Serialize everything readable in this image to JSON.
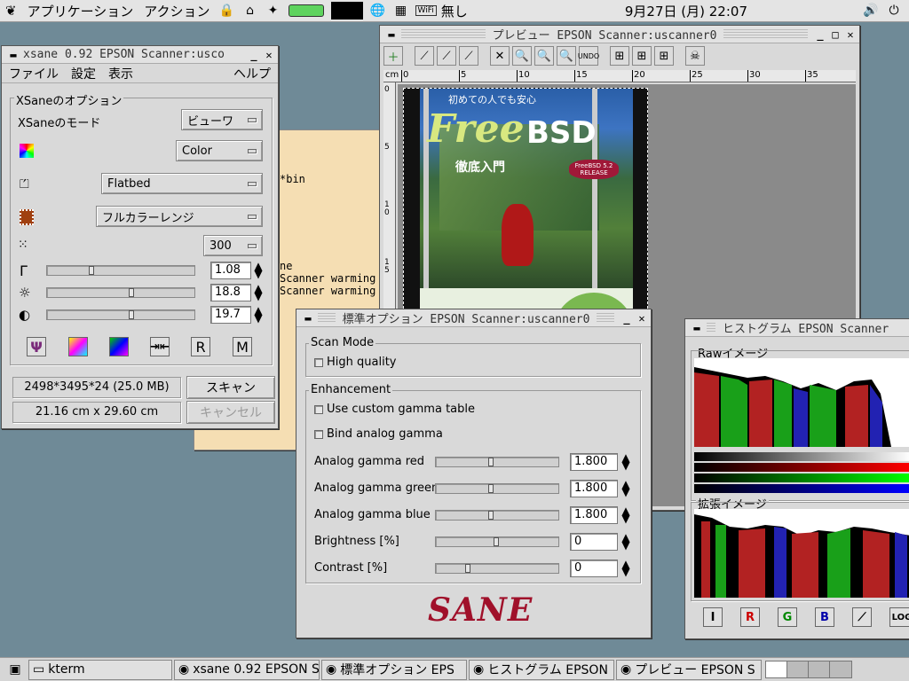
{
  "topbar": {
    "applications": "アプリケーション",
    "actions": "アクション",
    "wifi_label": "WiFi",
    "network_status": "無し",
    "clock": "9月27日 (月) 22:07"
  },
  "kterm": {
    "lines": [
      "*bin",
      "ne",
      "Scanner warming",
      "Scanner warming"
    ]
  },
  "xsane": {
    "title": "xsane 0.92 EPSON Scanner:usco",
    "menu": {
      "file": "ファイル",
      "settings": "設定",
      "view": "表示",
      "help": "ヘルプ"
    },
    "options_group": "XSaneのオプション",
    "mode_label": "XSaneのモード",
    "mode_value": "ビューワ",
    "color_value": "Color",
    "source_value": "Flatbed",
    "range_value": "フルカラーレンジ",
    "resolution_value": "300",
    "gamma_value": "1.08",
    "gamma_level": 0.3,
    "brightness_value": "18.8",
    "brightness_level": 0.58,
    "contrast_value": "19.7",
    "contrast_level": 0.58,
    "image_size": "2498*3495*24 (25.0 MB)",
    "dimensions": "21.16 cm x 29.60 cm",
    "scan_button": "スキャン",
    "cancel_button": "キャンセル",
    "bottom_buttons": [
      "R",
      "M"
    ]
  },
  "preview": {
    "title": "プレビュー EPSON Scanner:uscanner0",
    "unit": "cm",
    "ruler_ticks": [
      "0",
      "5",
      "10",
      "15",
      "20",
      "25",
      "30",
      "35"
    ],
    "vruler_ticks": [
      "0",
      "5",
      "10",
      "15"
    ],
    "cover_subtitle": "初めての人でも安心",
    "cover_title_a": "Free",
    "cover_title_b": "BSD",
    "cover_kanji": "徹底入門",
    "cover_badge": "FreeBSD 5.2 RELEASE"
  },
  "std_options": {
    "title": "標準オプション EPSON Scanner:uscanner0",
    "scan_mode_group": "Scan Mode",
    "high_quality": "High quality",
    "enhancement_group": "Enhancement",
    "custom_gamma": "Use custom gamma table",
    "bind_gamma": "Bind analog gamma",
    "rows": [
      {
        "label": "Analog gamma red",
        "value": "1.800",
        "level": 0.45
      },
      {
        "label": "Analog gamma green",
        "value": "1.800",
        "level": 0.45
      },
      {
        "label": "Analog gamma blue",
        "value": "1.800",
        "level": 0.45
      },
      {
        "label": "Brightness [%]",
        "value": "0",
        "level": 0.5
      },
      {
        "label": "Contrast [%]",
        "value": "0",
        "level": 0.25
      }
    ],
    "logo": "SANE"
  },
  "histogram": {
    "title": "ヒストグラム EPSON Scanner",
    "raw_label": "Rawイメージ",
    "enhanced_label": "拡張イメージ",
    "buttons": [
      "I",
      "R",
      "G",
      "B",
      "LOG"
    ]
  },
  "taskbar": {
    "items": [
      "kterm",
      "xsane 0.92 EPSON S",
      "標準オプション EPS",
      "ヒストグラム EPSON",
      "プレビュー EPSON S"
    ]
  },
  "colors": {
    "active_title": "#1f3f7a",
    "desktop": "#6f8a97",
    "kterm_bg": "#f5deb3"
  }
}
